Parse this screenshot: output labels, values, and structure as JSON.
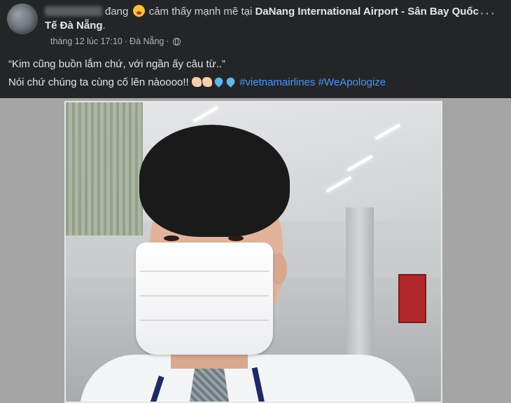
{
  "header": {
    "verb": "đang",
    "feeling": "cảm thấy mạnh mẽ tại",
    "location": "DaNang International Airport - Sân Bay Quốc Tế Đà Nẵng",
    "period": "."
  },
  "meta": {
    "time": "tháng 12 lúc 17:10",
    "separator": "·",
    "place": "Đà Nẵng",
    "separator2": "·"
  },
  "menu": {
    "more": "···"
  },
  "caption": {
    "line1": "“Kim cũng buồn lắm chứ, với ngần ấy câu từ..”",
    "line2": "Nói chứ chúng ta cùng cố lên nàoooo!!",
    "hashtags": [
      "#vietnamairlines",
      "#WeApologize"
    ]
  },
  "icons": {
    "feeling": "crying-emoji-icon",
    "privacy": "globe-icon",
    "emojis": [
      "flexed-biceps-icon",
      "flexed-biceps-icon",
      "blue-heart-icon",
      "blue-heart-icon"
    ]
  },
  "colors": {
    "background": "#242526",
    "text": "#e4e6eb",
    "secondary": "#b0b3b8",
    "link": "#4599ff",
    "photo_border": "#a5a5a5"
  }
}
